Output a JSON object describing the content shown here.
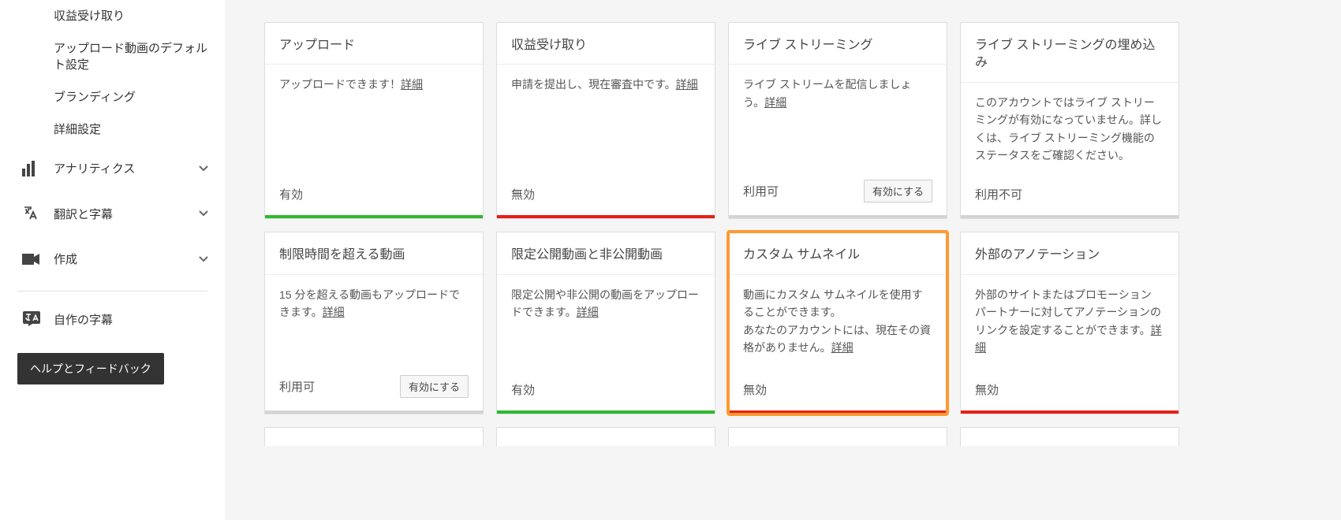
{
  "sidebar": {
    "subItems": [
      "収益受け取り",
      "アップロード動画のデフォルト設定",
      "ブランディング",
      "詳細設定"
    ],
    "sections": [
      {
        "label": "アナリティクス",
        "icon": "analytics"
      },
      {
        "label": "翻訳と字幕",
        "icon": "translate"
      },
      {
        "label": "作成",
        "icon": "create"
      }
    ],
    "captionsLink": "自作の字幕",
    "helpButton": "ヘルプとフィードバック"
  },
  "detailLinkText": "詳細",
  "cards": [
    {
      "title": "アップロード",
      "bodyPre": "アップロードできます！",
      "bodyPost": "",
      "hasDetail": true,
      "status": "有効",
      "statusColor": "green",
      "button": null,
      "highlighted": false
    },
    {
      "title": "収益受け取り",
      "bodyPre": "申請を提出し、現在審査中です。",
      "bodyPost": "",
      "hasDetail": true,
      "status": "無効",
      "statusColor": "red",
      "button": null,
      "highlighted": false
    },
    {
      "title": "ライブ ストリーミング",
      "bodyPre": "ライブ ストリームを配信しましょう。",
      "bodyPost": "",
      "hasDetail": true,
      "status": "利用可",
      "statusColor": "grey",
      "button": "有効にする",
      "highlighted": false
    },
    {
      "title": "ライブ ストリーミングの埋め込み",
      "bodyPre": "このアカウントではライブ ストリーミングが有効になっていません。詳しくは、ライブ ストリーミング機能のステータスをご確認ください。",
      "bodyPost": "",
      "hasDetail": false,
      "status": "利用不可",
      "statusColor": "grey",
      "button": null,
      "highlighted": false
    },
    {
      "title": "制限時間を超える動画",
      "bodyPre": "15 分を超える動画もアップロードできます。",
      "bodyPost": "",
      "hasDetail": true,
      "status": "利用可",
      "statusColor": "grey",
      "button": "有効にする",
      "highlighted": false
    },
    {
      "title": "限定公開動画と非公開動画",
      "bodyPre": "限定公開や非公開の動画をアップロードできます。",
      "bodyPost": "",
      "hasDetail": true,
      "status": "有効",
      "statusColor": "green",
      "button": null,
      "highlighted": false
    },
    {
      "title": "カスタム サムネイル",
      "bodyPre": "動画にカスタム サムネイルを使用することができます。",
      "bodyPost": "あなたのアカウントには、現在その資格がありません。",
      "hasDetail": true,
      "status": "無効",
      "statusColor": "red",
      "button": null,
      "highlighted": true
    },
    {
      "title": "外部のアノテーション",
      "bodyPre": "外部のサイトまたはプロモーション パートナーに対してアノテーションのリンクを設定することができます。",
      "bodyPost": "",
      "hasDetail": true,
      "status": "無効",
      "statusColor": "red",
      "button": null,
      "highlighted": false
    }
  ]
}
